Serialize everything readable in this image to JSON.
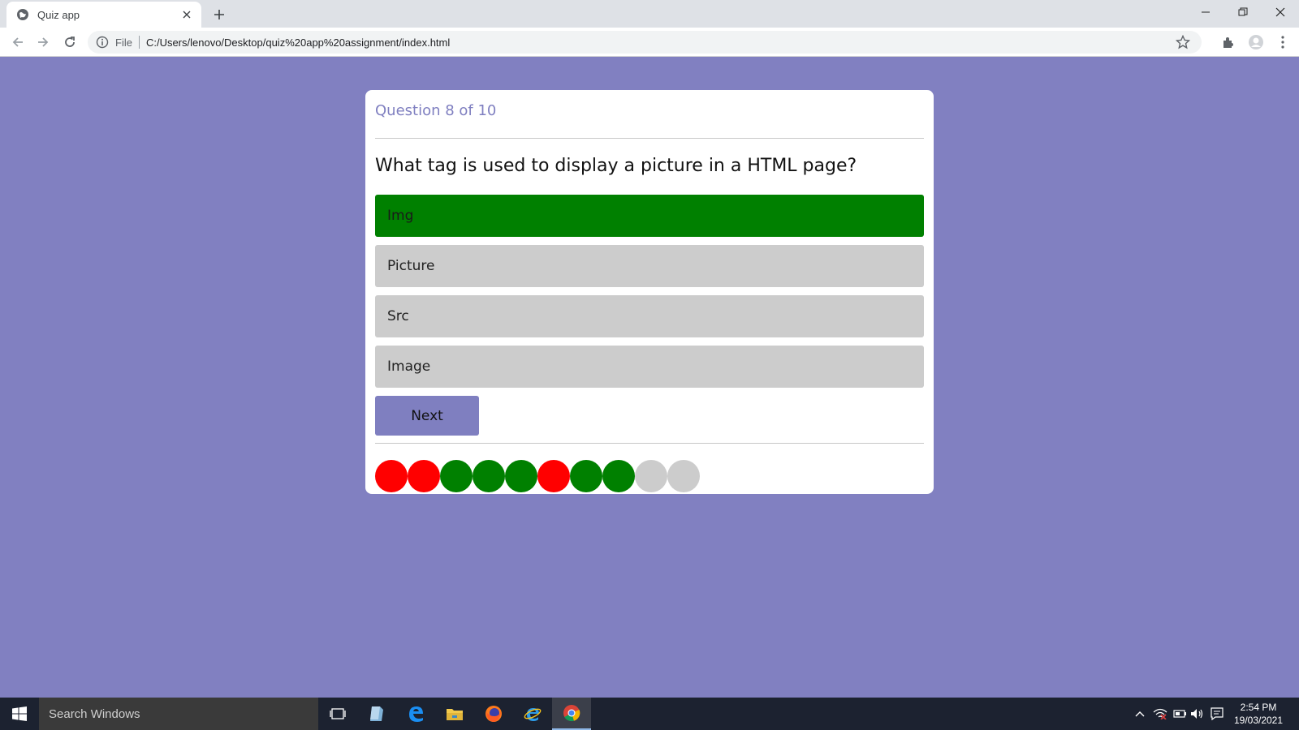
{
  "browser": {
    "tab_title": "Quiz app",
    "url_scheme": "File",
    "url": "C:/Users/lenovo/Desktop/quiz%20app%20assignment/index.html"
  },
  "quiz": {
    "counter": "Question 8 of 10",
    "question": "What tag is used to display a picture in a HTML page?",
    "options": [
      {
        "label": "Img",
        "state": "correct"
      },
      {
        "label": "Picture",
        "state": "neutral"
      },
      {
        "label": "Src",
        "state": "neutral"
      },
      {
        "label": "Image",
        "state": "neutral"
      }
    ],
    "next_label": "Next",
    "progress": [
      "wrong",
      "wrong",
      "correct",
      "correct",
      "correct",
      "wrong",
      "correct",
      "correct",
      "pending",
      "pending"
    ]
  },
  "colors": {
    "background": "#8180c1",
    "accent": "#7f7fc0",
    "correct": "#008000",
    "wrong": "#ff0000",
    "pending": "#cccccc"
  },
  "taskbar": {
    "search_placeholder": "Search Windows",
    "time": "2:54 PM",
    "date": "19/03/2021",
    "apps": [
      "task-view-icon",
      "file-icon",
      "edge-icon",
      "file-explorer-icon",
      "firefox-icon",
      "internet-explorer-icon",
      "chrome-icon"
    ]
  }
}
